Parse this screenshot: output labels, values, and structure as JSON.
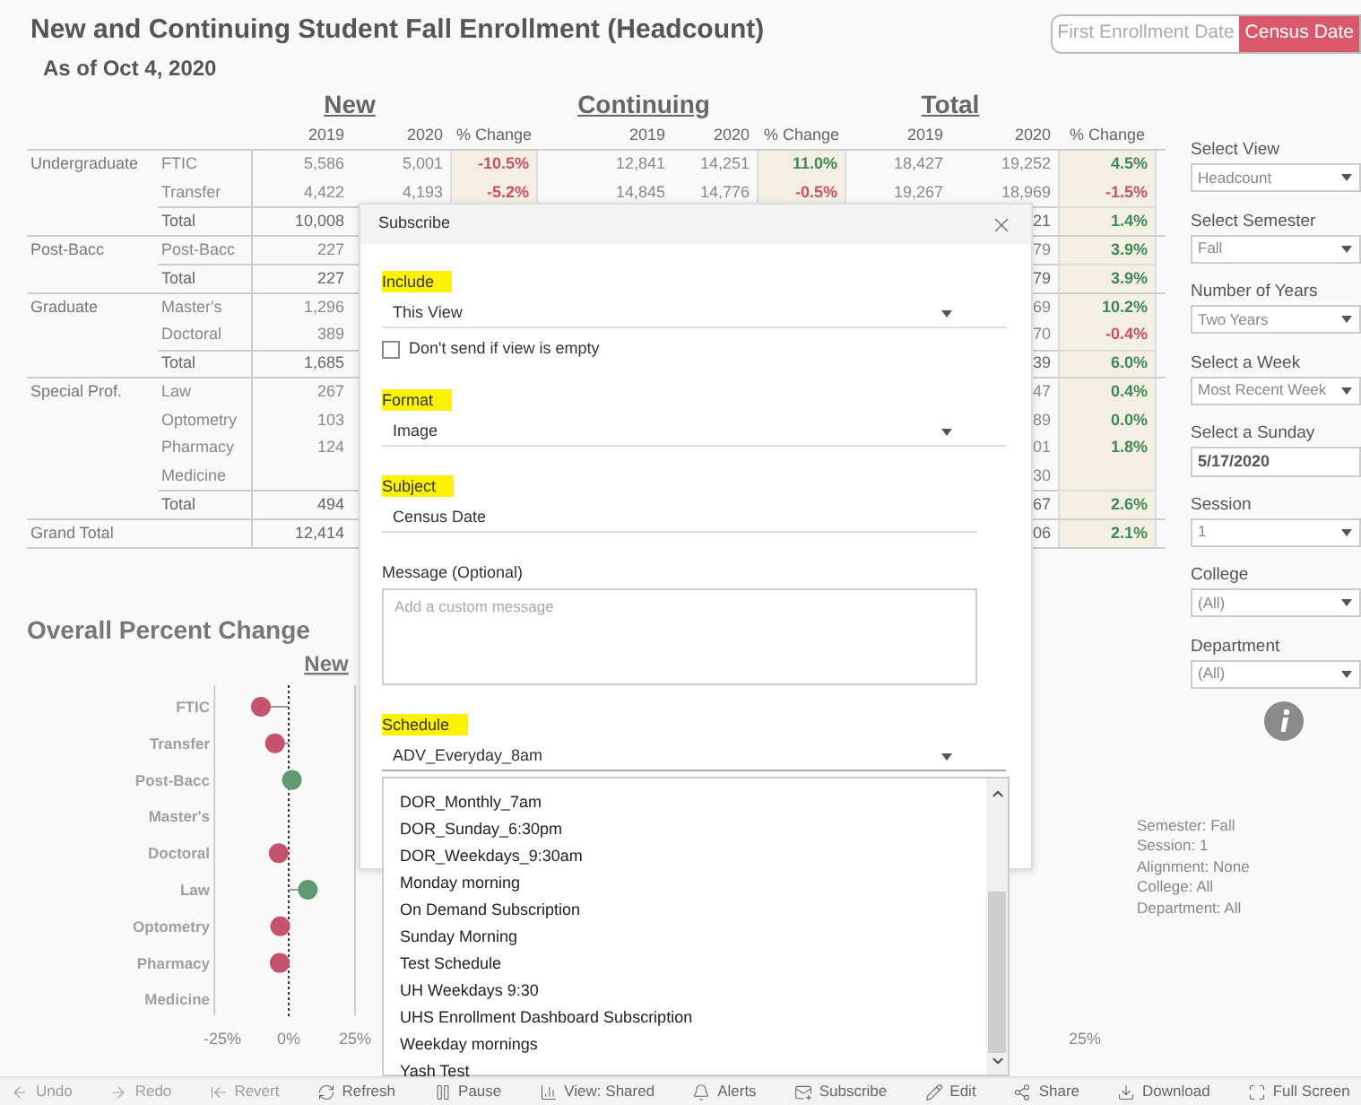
{
  "title": "New and Continuing Student Fall Enrollment (Headcount)",
  "subtitle": "As of Oct 4, 2020",
  "date_toggle": [
    {
      "label": "First Enrollment Date",
      "selected": false
    },
    {
      "label": "Census Date",
      "selected": true
    }
  ],
  "table": {
    "sections": [
      "New",
      "Continuing",
      "Total"
    ],
    "columns": [
      "2019",
      "2020",
      "% Change",
      "2019",
      "2020",
      "% Change",
      "2019",
      "2020",
      "% Change"
    ],
    "groups": [
      {
        "name": "Undergraduate",
        "rows": [
          {
            "label": "FTIC",
            "kind": "detail",
            "new_2019": "5,586",
            "new_2020": "5,001",
            "new_change": {
              "text": "-10.5%",
              "negative": true
            },
            "cont_2019": "12,841",
            "cont_2020": "14,251",
            "cont_change": {
              "text": "11.0%",
              "negative": false
            },
            "total_2019": "18,427",
            "total_2020": "19,252",
            "total_change": {
              "text": "4.5%",
              "negative": false
            }
          },
          {
            "label": "Transfer",
            "kind": "detail",
            "new_2019": "4,422",
            "new_2020": "4,193",
            "new_change": {
              "text": "-5.2%",
              "negative": true
            },
            "cont_2019": "14,845",
            "cont_2020": "14,776",
            "cont_change": {
              "text": "-0.5%",
              "negative": true
            },
            "total_2019": "19,267",
            "total_2020": "18,969",
            "total_change": {
              "text": "-1.5%",
              "negative": true
            }
          },
          {
            "label": "Total",
            "kind": "total",
            "new_2019": "10,008",
            "total_2020": "21",
            "total_change": {
              "text": "1.4%",
              "negative": false
            }
          }
        ]
      },
      {
        "name": "Post-Bacc",
        "rows": [
          {
            "label": "Post-Bacc",
            "kind": "detail",
            "new_2019": "227",
            "total_2020": "79",
            "total_change": {
              "text": "3.9%",
              "negative": false
            }
          },
          {
            "label": "Total",
            "kind": "total",
            "new_2019": "227",
            "total_2020": "79",
            "total_change": {
              "text": "3.9%",
              "negative": false
            }
          }
        ]
      },
      {
        "name": "Graduate",
        "rows": [
          {
            "label": "Master's",
            "kind": "detail",
            "new_2019": "1,296",
            "total_2020": "69",
            "total_change": {
              "text": "10.2%",
              "negative": false
            }
          },
          {
            "label": "Doctoral",
            "kind": "detail",
            "new_2019": "389",
            "total_2020": "70",
            "total_change": {
              "text": "-0.4%",
              "negative": true
            }
          },
          {
            "label": "Total",
            "kind": "total",
            "new_2019": "1,685",
            "total_2020": "39",
            "total_change": {
              "text": "6.0%",
              "negative": false
            }
          }
        ]
      },
      {
        "name": "Special Prof.",
        "rows": [
          {
            "label": "Law",
            "kind": "detail",
            "new_2019": "267",
            "total_2020": "47",
            "total_change": {
              "text": "0.4%",
              "negative": false
            }
          },
          {
            "label": "Optometry",
            "kind": "detail",
            "new_2019": "103",
            "total_2020": "89",
            "total_change": {
              "text": "0.0%",
              "negative": false
            }
          },
          {
            "label": "Pharmacy",
            "kind": "detail",
            "new_2019": "124",
            "total_2020": "01",
            "total_change": {
              "text": "1.8%",
              "negative": false
            }
          },
          {
            "label": "Medicine",
            "kind": "detail",
            "total_2020": "30"
          },
          {
            "label": "Total",
            "kind": "total",
            "new_2019": "494",
            "total_2020": "67",
            "total_change": {
              "text": "2.6%",
              "negative": false
            }
          }
        ]
      },
      {
        "name": "Grand Total",
        "rows": [
          {
            "kind": "grand",
            "new_2019": "12,414",
            "total_2020": "06",
            "total_change": {
              "text": "2.1%",
              "negative": false
            }
          }
        ]
      }
    ]
  },
  "overall_chart": {
    "title": "Overall Percent Change",
    "chart_data": {
      "type": "scatter",
      "orientation": "horizontal",
      "title": "New",
      "categories": [
        "FTIC",
        "Transfer",
        "Post-Bacc",
        "Master's",
        "Doctoral",
        "Law",
        "Optometry",
        "Pharmacy",
        "Medicine"
      ],
      "values": [
        -10.5,
        -5.2,
        1.2,
        null,
        -3.8,
        7.2,
        -3.2,
        -3.4,
        null
      ],
      "xlim": [
        -28,
        25
      ],
      "xticks": [
        {
          "value": -25,
          "label": "-25%"
        },
        {
          "value": 0,
          "label": "0%"
        },
        {
          "value": 25,
          "label": "25%"
        }
      ]
    },
    "next_panel_tick": "25%"
  },
  "filters": [
    {
      "label": "Select View",
      "kind": "dropdown",
      "value": "Headcount"
    },
    {
      "label": "Select Semester",
      "kind": "dropdown",
      "value": "Fall"
    },
    {
      "label": "Number of Years",
      "kind": "dropdown",
      "value": "Two Years"
    },
    {
      "label": "Select a Week",
      "kind": "dropdown",
      "value": "Most Recent Week"
    },
    {
      "label": "Select a Sunday",
      "kind": "date",
      "value": "5/17/2020"
    },
    {
      "label": "Session",
      "kind": "dropdown",
      "value": "1"
    },
    {
      "label": "College",
      "kind": "dropdown",
      "value": "(All)"
    },
    {
      "label": "Department",
      "kind": "dropdown",
      "value": "(All)"
    }
  ],
  "summary": [
    "Semester: Fall",
    "Session: 1",
    "Alignment: None",
    "College: All",
    "Department: All"
  ],
  "subscribe_dialog": {
    "title": "Subscribe",
    "fields": [
      {
        "kind": "select",
        "label": "Include",
        "highlighted": true,
        "value": "This View"
      },
      {
        "kind": "checkbox",
        "label": "Don't send if view is empty",
        "checked": false
      },
      {
        "kind": "select",
        "label": "Format",
        "highlighted": true,
        "value": "Image"
      },
      {
        "kind": "text",
        "label": "Subject",
        "highlighted": true,
        "value": "Census Date"
      },
      {
        "kind": "textarea",
        "label": "Message (Optional)",
        "highlighted": false,
        "placeholder": "Add a custom message"
      },
      {
        "kind": "select",
        "label": "Schedule",
        "highlighted": true,
        "value": "ADV_Everyday_8am",
        "expanded": true
      }
    ],
    "schedule_options": [
      "DOR_Monthly_7am",
      "DOR_Sunday_6:30pm",
      "DOR_Weekdays_9:30am",
      "Monday morning",
      "On Demand Subscription",
      "Sunday Morning",
      "Test Schedule",
      "UH Weekdays 9:30",
      "UHS Enrollment Dashboard Subscription",
      "Weekday mornings",
      "Yash Test"
    ]
  },
  "toolbar": [
    {
      "label": "Undo",
      "disabled": true
    },
    {
      "label": "Redo",
      "disabled": true
    },
    {
      "label": "Revert",
      "disabled": true
    },
    {
      "label": "Refresh",
      "disabled": false
    },
    {
      "label": "Pause",
      "disabled": false
    },
    {
      "label": "View: Shared",
      "disabled": false
    },
    {
      "label": "Alerts",
      "disabled": false
    },
    {
      "label": "Subscribe",
      "disabled": false
    },
    {
      "label": "Edit",
      "disabled": false
    },
    {
      "label": "Share",
      "disabled": false
    },
    {
      "label": "Download",
      "disabled": false
    },
    {
      "label": "Full Screen",
      "disabled": false
    }
  ]
}
